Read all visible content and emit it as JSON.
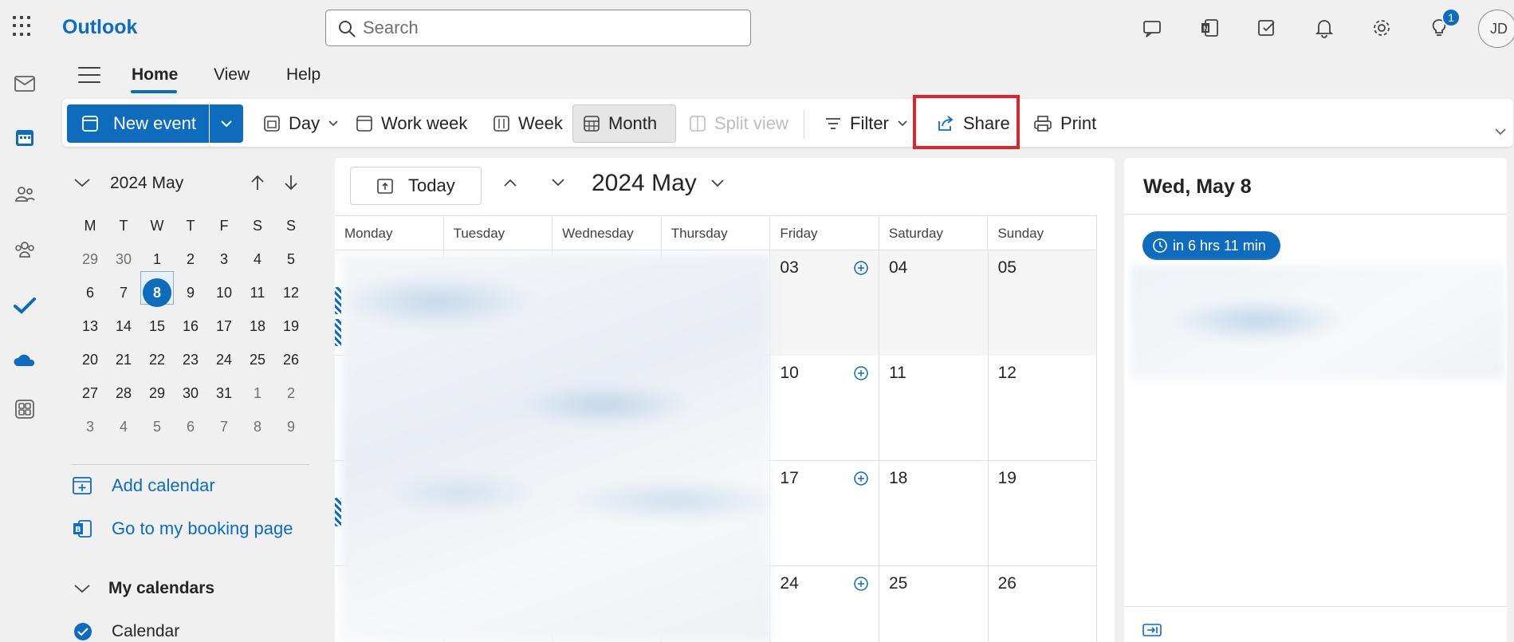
{
  "app": {
    "name": "Outlook"
  },
  "search": {
    "placeholder": "Search"
  },
  "notifications": {
    "tips_badge": "1"
  },
  "user": {
    "initials": "JD"
  },
  "ribbon_tabs": [
    "Home",
    "View",
    "Help"
  ],
  "toolbar": {
    "new_event": "New event",
    "day": "Day",
    "work_week": "Work week",
    "week": "Week",
    "month": "Month",
    "split_view": "Split view",
    "filter": "Filter",
    "share": "Share",
    "print": "Print"
  },
  "mini_calendar": {
    "title": "2024 May",
    "weekday_headers": [
      "M",
      "T",
      "W",
      "T",
      "F",
      "S",
      "S"
    ],
    "weeks": [
      [
        "29",
        "30",
        "1",
        "2",
        "3",
        "4",
        "5"
      ],
      [
        "6",
        "7",
        "8",
        "9",
        "10",
        "11",
        "12"
      ],
      [
        "13",
        "14",
        "15",
        "16",
        "17",
        "18",
        "19"
      ],
      [
        "20",
        "21",
        "22",
        "23",
        "24",
        "25",
        "26"
      ],
      [
        "27",
        "28",
        "29",
        "30",
        "31",
        "1",
        "2"
      ],
      [
        "3",
        "4",
        "5",
        "6",
        "7",
        "8",
        "9"
      ]
    ],
    "today": "8"
  },
  "sidebar_links": {
    "add_calendar": "Add calendar",
    "booking_page": "Go to my booking page"
  },
  "my_calendars": {
    "heading": "My calendars",
    "items": [
      "Calendar"
    ]
  },
  "main_calendar": {
    "today_button": "Today",
    "title": "2024 May",
    "day_headers": [
      "Monday",
      "Tuesday",
      "Wednesday",
      "Thursday",
      "Friday",
      "Saturday",
      "Sunday"
    ],
    "visible_dates": [
      [
        "03",
        "04",
        "05"
      ],
      [
        "10",
        "11",
        "12"
      ],
      [
        "17",
        "18",
        "19"
      ],
      [
        "24",
        "25",
        "26"
      ]
    ]
  },
  "day_pane": {
    "title": "Wed, May 8",
    "countdown": "in 6 hrs 11 min"
  },
  "colors": {
    "accent": "#0f6cbd",
    "highlight_box": "#d9262e"
  }
}
